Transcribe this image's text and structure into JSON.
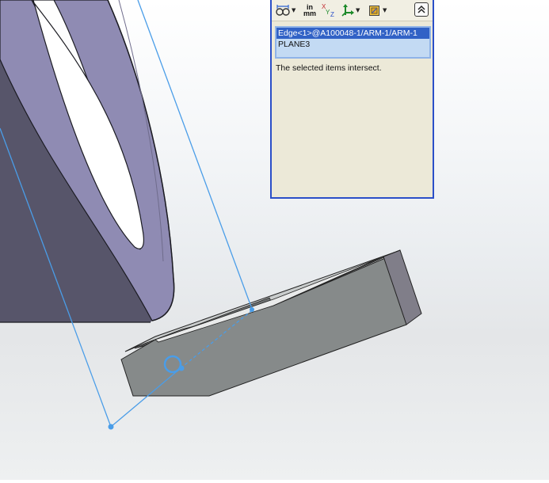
{
  "viewport": {
    "background_top": "#ffffff",
    "background_bottom": "#e4e6e8",
    "model_face_color": "#8f8bb3",
    "model_side_color": "#57556a",
    "arm_top_color": "#9a9d9d",
    "arm_front_color": "#868a8a",
    "arm_end_color": "#7f7e88",
    "selection_color": "#4a9de8"
  },
  "measure_panel": {
    "toolbar": {
      "arc_condition_icon": "arc-circle-condition-icon",
      "units_label_top": "in",
      "units_label_bottom": "mm",
      "xyz_icon": "xyz-dx-dy-dz-icon",
      "coordinate_system_icon": "coordinate-system-icon",
      "projection_icon": "projection-icon",
      "collapse_icon": "chevron-up-double-icon"
    },
    "selection_items": [
      "Edge<1>@A100048-1/ARM-1/ARM-1",
      "PLANE3"
    ],
    "result_text": "The selected items intersect."
  }
}
